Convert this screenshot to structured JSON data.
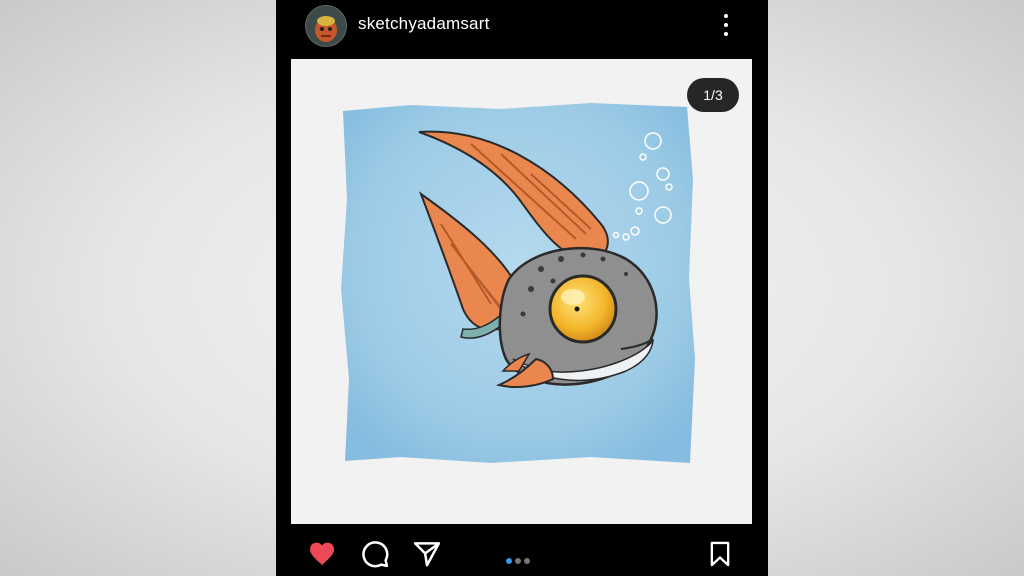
{
  "post": {
    "username": "sketchyadamsart",
    "counter": "1/3",
    "current_slide": 1,
    "total_slides": 3,
    "liked": true
  },
  "icons": {
    "more": "more-vertical-icon",
    "like": "heart-filled-icon",
    "comment": "comment-icon",
    "share": "send-icon",
    "save": "bookmark-icon"
  },
  "colors": {
    "like": "#ed4956",
    "active_dot": "#3897f0",
    "inactive_dot": "#777777",
    "background": "#000000"
  }
}
